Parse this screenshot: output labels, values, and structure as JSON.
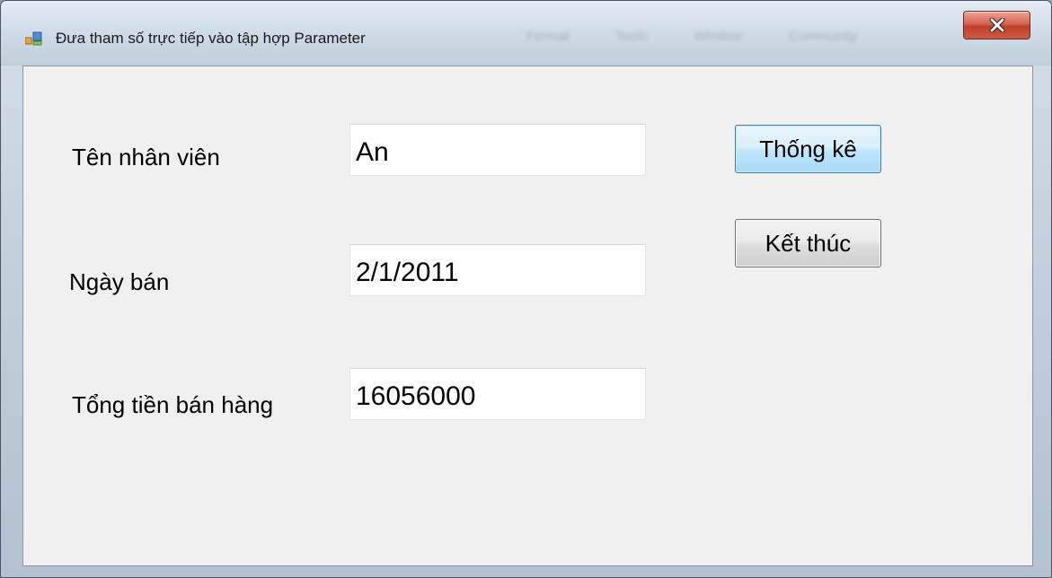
{
  "window": {
    "title": "Đưa tham số trực tiếp vào tập hợp Parameter",
    "background_menu": [
      "Format",
      "Tools",
      "Window",
      "Community"
    ]
  },
  "form": {
    "employee_label": "Tên nhân viên",
    "employee_value": "An",
    "date_label": "Ngày bán",
    "date_value": "2/1/2011",
    "total_label": "Tổng tiền bán hàng",
    "total_value": "16056000"
  },
  "buttons": {
    "statistics_label": "Thống kê",
    "exit_label": "Kết thúc"
  },
  "icons": {
    "app": "form-app-icon",
    "close": "close-icon"
  },
  "colors": {
    "close_button": "#c8452f",
    "default_button_border": "#3c7fb1",
    "form_background": "#f0f0f0"
  }
}
